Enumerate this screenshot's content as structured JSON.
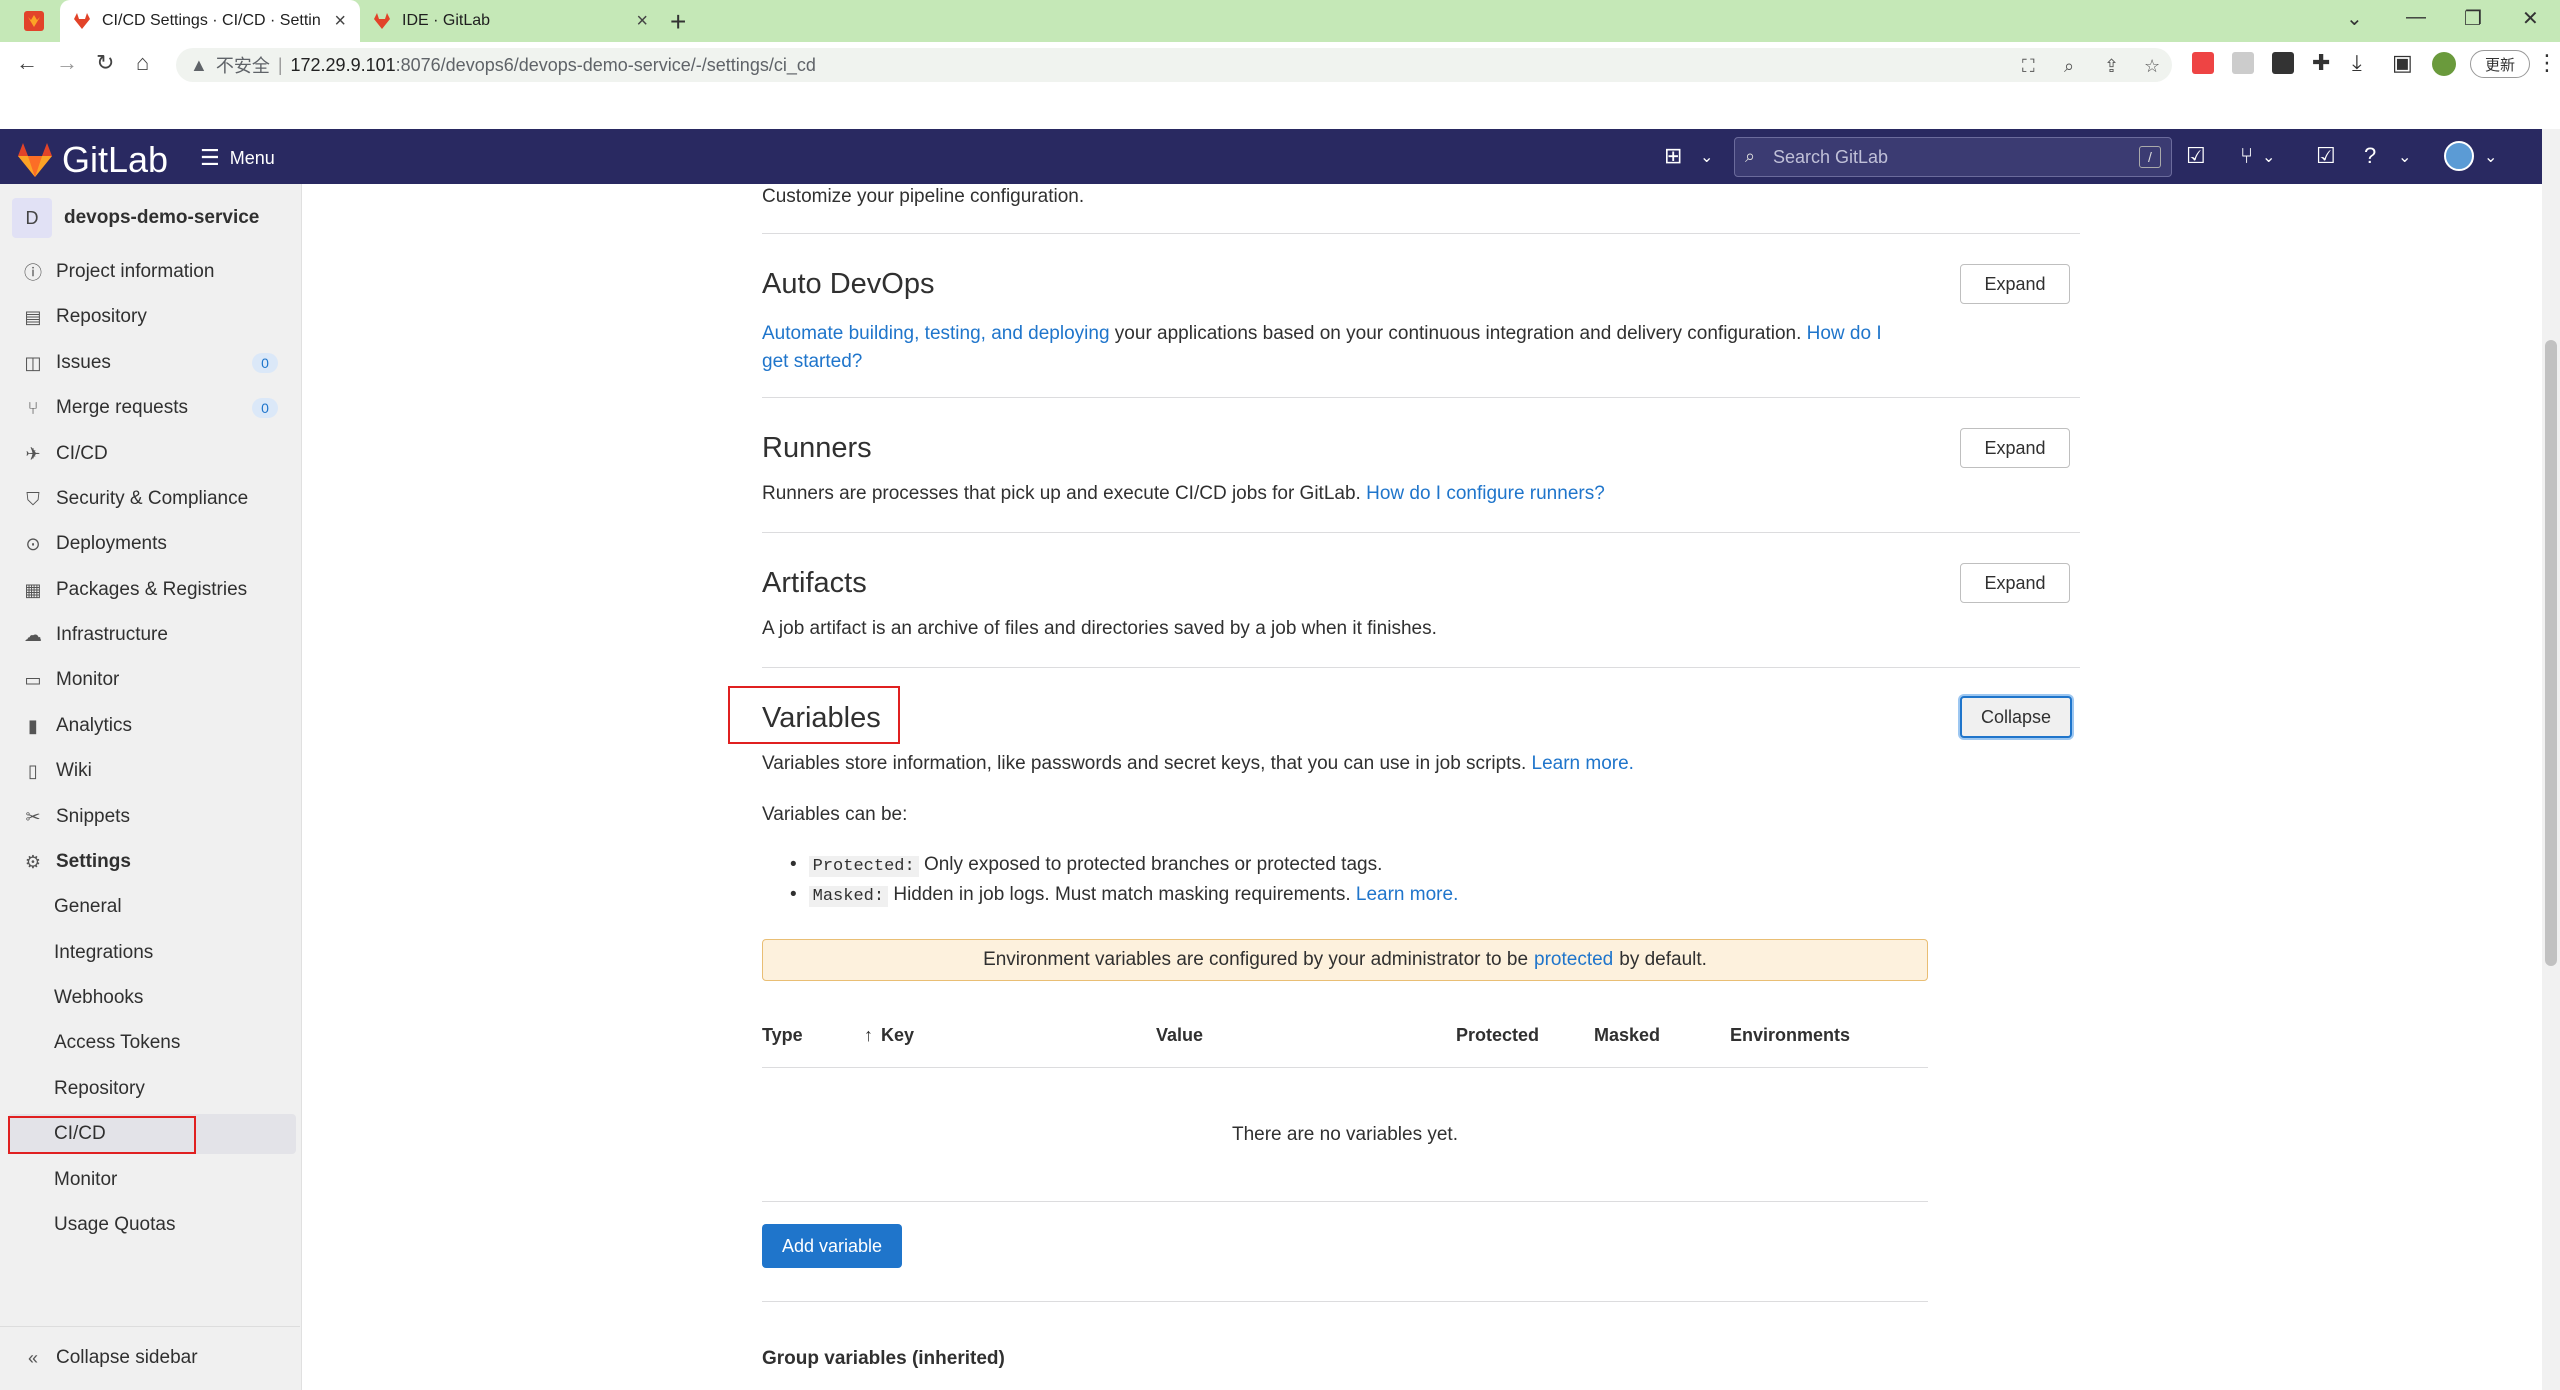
{
  "browser": {
    "tabs": [
      {
        "title": "CI/CD Settings · CI/CD · Settin",
        "active": true
      },
      {
        "title": "IDE · GitLab",
        "active": false
      }
    ],
    "url_insecure": "不安全",
    "url_host": "172.29.9.101",
    "url_path": ":8076/devops6/devops-demo-service/-/settings/ci_cd",
    "update_label": "更新"
  },
  "header": {
    "brand": "GitLab",
    "menu_label": "Menu",
    "search_placeholder": "Search GitLab",
    "search_shortcut": "/"
  },
  "sidebar": {
    "project_initial": "D",
    "project_name": "devops-demo-service",
    "items": [
      {
        "label": "Project information",
        "icon": "info-icon"
      },
      {
        "label": "Repository",
        "icon": "doc-icon"
      },
      {
        "label": "Issues",
        "icon": "issues-icon",
        "badge": "0"
      },
      {
        "label": "Merge requests",
        "icon": "merge-icon",
        "badge": "0"
      },
      {
        "label": "CI/CD",
        "icon": "rocket-icon"
      },
      {
        "label": "Security & Compliance",
        "icon": "shield-icon"
      },
      {
        "label": "Deployments",
        "icon": "deploy-icon"
      },
      {
        "label": "Packages & Registries",
        "icon": "package-icon"
      },
      {
        "label": "Infrastructure",
        "icon": "cloud-icon"
      },
      {
        "label": "Monitor",
        "icon": "monitor-icon"
      },
      {
        "label": "Analytics",
        "icon": "chart-icon"
      },
      {
        "label": "Wiki",
        "icon": "book-icon"
      },
      {
        "label": "Snippets",
        "icon": "scissors-icon"
      },
      {
        "label": "Settings",
        "icon": "gear-icon"
      }
    ],
    "sub_items": [
      "General",
      "Integrations",
      "Webhooks",
      "Access Tokens",
      "Repository",
      "CI/CD",
      "Monitor",
      "Usage Quotas"
    ],
    "collapse_label": "Collapse sidebar"
  },
  "main": {
    "pipeline_desc": "Customize your pipeline configuration.",
    "auto_devops": {
      "title": "Auto DevOps",
      "link1": "Automate building, testing, and deploying",
      "text": " your applications based on your continuous integration and delivery configuration. ",
      "link2a": "How do I",
      "link2b": "get started?",
      "button": "Expand"
    },
    "runners": {
      "title": "Runners",
      "text": "Runners are processes that pick up and execute CI/CD jobs for GitLab. ",
      "link": "How do I configure runners?",
      "button": "Expand"
    },
    "artifacts": {
      "title": "Artifacts",
      "text": "A job artifact is an archive of files and directories saved by a job when it finishes.",
      "button": "Expand"
    },
    "variables": {
      "title": "Variables",
      "text": "Variables store information, like passwords and secret keys, that you can use in job scripts. ",
      "link": "Learn more.",
      "button": "Collapse",
      "can_be": "Variables can be:",
      "protected_code": "Protected:",
      "protected_text": " Only exposed to protected branches or protected tags.",
      "masked_code": "Masked:",
      "masked_text": " Hidden in job logs. Must match masking requirements. ",
      "masked_link": "Learn more.",
      "alert_pre": "Environment variables are configured by your administrator to be ",
      "alert_link": "protected",
      "alert_post": " by default.",
      "columns": [
        "Type",
        "Key",
        "Value",
        "Protected",
        "Masked",
        "Environments"
      ],
      "empty": "There are no variables yet.",
      "add_button": "Add variable",
      "group_vars": "Group variables (inherited)"
    }
  }
}
